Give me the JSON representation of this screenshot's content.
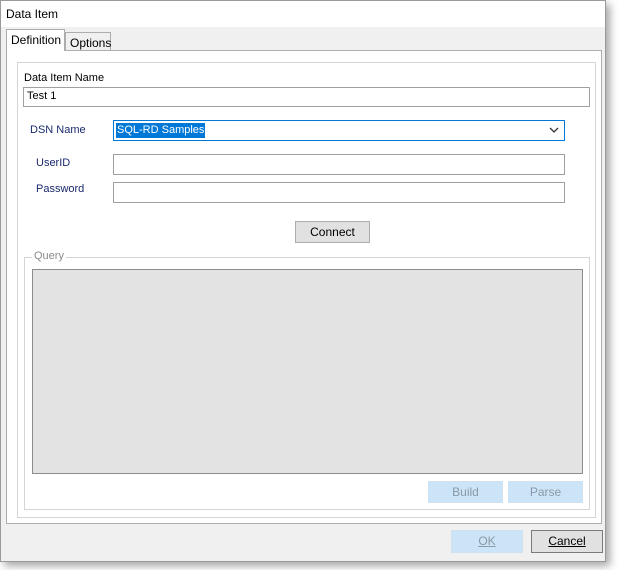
{
  "window": {
    "title": "Data Item"
  },
  "tabs": [
    {
      "label": "Definition",
      "active": true
    },
    {
      "label": "Options",
      "active": false
    }
  ],
  "form": {
    "data_item_name_label": "Data Item Name",
    "data_item_name_value": "Test 1",
    "dsn_label": "DSN Name",
    "dsn_value": "SQL-RD Samples",
    "userid_label": "UserID",
    "userid_value": "",
    "password_label": "Password",
    "password_value": "",
    "connect_label": "Connect"
  },
  "query": {
    "legend": "Query",
    "build_label": "Build",
    "parse_label": "Parse"
  },
  "footer": {
    "ok_label": "OK",
    "cancel_label": "Cancel"
  },
  "colors": {
    "accent": "#0078d7",
    "dialog_bg": "#f0f0f0",
    "query_bg": "#e3e3e3"
  }
}
